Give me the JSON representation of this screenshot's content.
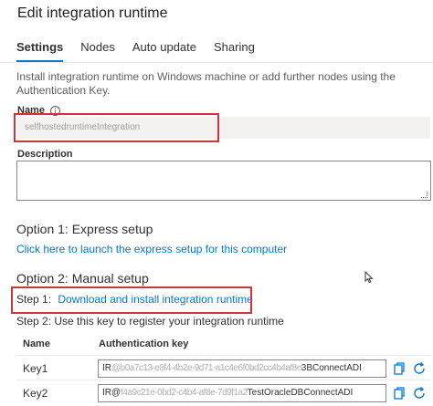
{
  "panel": {
    "title": "Edit integration runtime"
  },
  "tabs": [
    {
      "label": "Settings",
      "active": true
    },
    {
      "label": "Nodes",
      "active": false
    },
    {
      "label": "Auto update",
      "active": false
    },
    {
      "label": "Sharing",
      "active": false
    }
  ],
  "intro_text": "Install integration runtime on Windows machine or add further nodes using the Authentication Key.",
  "name_field": {
    "label": "Name",
    "value": "selfhostedruntimeIntegration"
  },
  "description_field": {
    "label": "Description",
    "value": ""
  },
  "option1": {
    "heading": "Option 1: Express setup",
    "link": "Click here to launch the express setup for this computer"
  },
  "option2": {
    "heading": "Option 2: Manual setup",
    "step1_prefix": "Step 1:",
    "step1_link": "Download and install integration runtime",
    "step2_text": "Step 2: Use this key to register your integration runtime"
  },
  "keys_table": {
    "columns": [
      "Name",
      "Authentication key"
    ],
    "rows": [
      {
        "name": "Key1",
        "value_prefix": "IR",
        "value_obscured": "@b0a7c13-e8f4-4b2e-9d71-a1c4e6f0bd2cc4b4af8e",
        "value_suffix": "3BConnectADI"
      },
      {
        "name": "Key2",
        "value_prefix": "IR@",
        "value_obscured": "f4a9c21e-0bd2-c4b4-af8e-7d9f1a2",
        "value_suffix": "TestOracleDBConnectADI"
      }
    ]
  },
  "colors": {
    "accent": "#0078d4",
    "highlight_box": "#d13438"
  },
  "icons": {
    "copy": "copy-icon",
    "refresh": "refresh-icon",
    "info": "info-icon"
  }
}
